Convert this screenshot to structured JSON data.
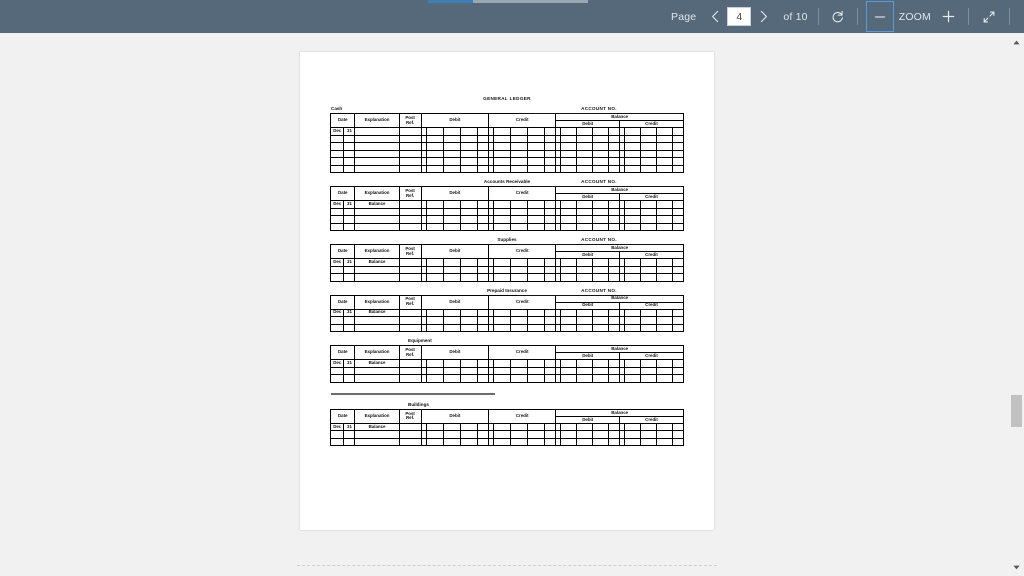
{
  "toolbar": {
    "page_label": "Page",
    "prev_icon": "chevron-left-icon",
    "page_number": "4",
    "next_icon": "chevron-right-icon",
    "of_label": "of 10",
    "rotate_icon": "rotate-icon",
    "zoom_out_label": "−",
    "zoom_label": "ZOOM",
    "zoom_in_label": "+",
    "fit_icon": "fit-page-icon"
  },
  "scrollbar": {
    "up_arrow": "▲",
    "down_arrow": "▼"
  },
  "document": {
    "title": "GENERAL LEDGER",
    "account_no_label": "ACCOUNT NO.",
    "columns": {
      "date": "Date",
      "explanation": "Explanation",
      "post_ref_l1": "Post",
      "post_ref_l2": "Ref.",
      "debit": "Debit",
      "credit": "Credit",
      "balance": "Balance",
      "balance_debit": "Debit",
      "balance_credit": "Credit"
    },
    "accounts": [
      {
        "name": "Cash",
        "title_align": "left",
        "show_account_no": true,
        "date_month": "Dec",
        "date_day": "31",
        "explanation": "",
        "data_rows": 6
      },
      {
        "name": "Accounts Receivable",
        "title_align": "center",
        "show_account_no": true,
        "date_month": "Dec",
        "date_day": "31",
        "explanation": "Balance",
        "data_rows": 4
      },
      {
        "name": "Supplies",
        "title_align": "center",
        "show_account_no": true,
        "date_month": "Dec",
        "date_day": "31",
        "explanation": "Balance",
        "data_rows": 3
      },
      {
        "name": "Prepaid Insurance",
        "title_align": "center",
        "show_account_no": true,
        "date_month": "Dec",
        "date_day": "31",
        "explanation": "Balance",
        "data_rows": 3
      },
      {
        "name": "Equipment",
        "title_align": "offleft",
        "show_account_no": false,
        "date_month": "Dec",
        "date_day": "31",
        "explanation": "Balance",
        "data_rows": 3
      },
      {
        "name": "Buildings",
        "title_align": "offleft",
        "show_account_no": false,
        "date_month": "Dec",
        "date_day": "31",
        "explanation": "Balance",
        "data_rows": 3,
        "divider_above": true
      }
    ]
  },
  "colors": {
    "toolbar_bg": "#56697a",
    "accent": "#5b9ad6",
    "progress_fill": "#3f7fb5",
    "viewer_bg": "#f1f1f1",
    "page_bg": "#ffffff",
    "scroll_thumb": "#c1c1c1",
    "rule": "#6d6d6d"
  }
}
